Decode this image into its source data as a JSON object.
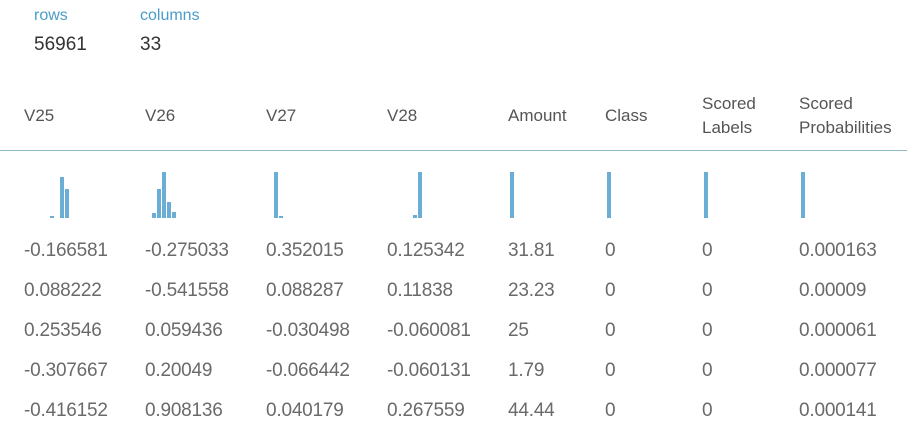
{
  "summary": {
    "rows_label": "rows",
    "rows_value": "56961",
    "columns_label": "columns",
    "columns_value": "33"
  },
  "colors": {
    "accent": "#4a9cc9",
    "bar": "#6aaed6",
    "separator": "#8fb9c8"
  },
  "table": {
    "headers": [
      {
        "line1": "V25",
        "line2": ""
      },
      {
        "line1": "V26",
        "line2": ""
      },
      {
        "line1": "V27",
        "line2": ""
      },
      {
        "line1": "V28",
        "line2": ""
      },
      {
        "line1": "Amount",
        "line2": ""
      },
      {
        "line1": "Class",
        "line2": ""
      },
      {
        "line1": "Scored",
        "line2": "Labels"
      },
      {
        "line1": "Scored",
        "line2": "Probabilities"
      }
    ],
    "histograms": [
      [
        0.02,
        0.0,
        0.9,
        0.62
      ],
      [
        0.1,
        0.62,
        1.0,
        0.35,
        0.12
      ],
      [
        1.0,
        0.05
      ],
      [
        0.06,
        1.0
      ],
      [
        1.0
      ],
      [
        1.0
      ],
      [
        1.0
      ],
      [
        1.0
      ]
    ],
    "rows": [
      [
        "-0.166581",
        "-0.275033",
        "0.352015",
        "0.125342",
        "31.81",
        "0",
        "0",
        "0.000163"
      ],
      [
        "0.088222",
        "-0.541558",
        "0.088287",
        "0.11838",
        "23.23",
        "0",
        "0",
        "0.00009"
      ],
      [
        "0.253546",
        "0.059436",
        "-0.030498",
        "-0.060081",
        "25",
        "0",
        "0",
        "0.000061"
      ],
      [
        "-0.307667",
        "0.20049",
        "-0.066442",
        "-0.060131",
        "1.79",
        "0",
        "0",
        "0.000077"
      ],
      [
        "-0.416152",
        "0.908136",
        "0.040179",
        "0.267559",
        "44.44",
        "0",
        "0",
        "0.000141"
      ]
    ]
  }
}
